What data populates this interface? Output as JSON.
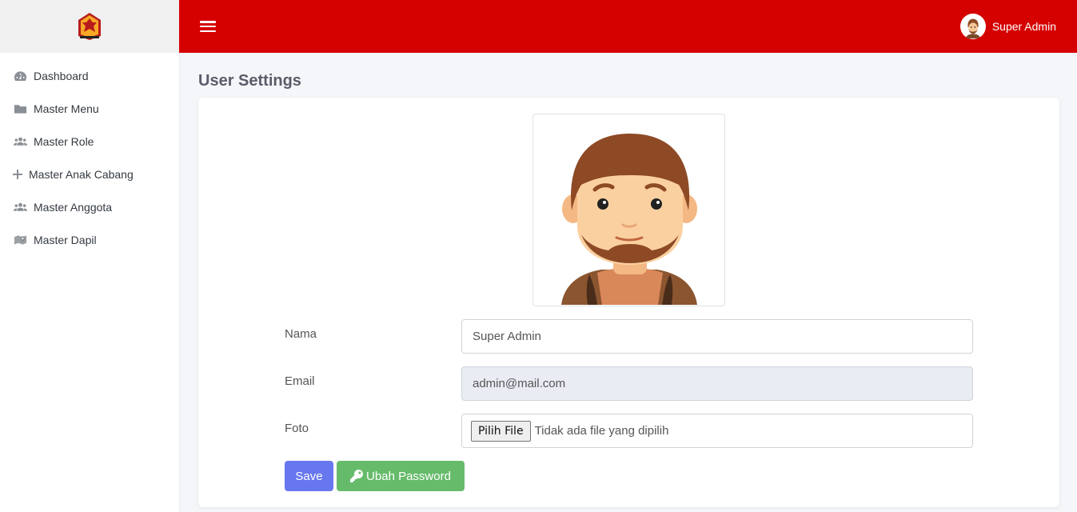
{
  "sidebar": {
    "logo_icon": "gerindra-garuda-logo",
    "items": [
      {
        "label": "Dashboard",
        "icon": "tachometer-icon"
      },
      {
        "label": "Master Menu",
        "icon": "folder-icon"
      },
      {
        "label": "Master Role",
        "icon": "users-icon"
      },
      {
        "label": "Master Anak Cabang",
        "icon": "plus-icon"
      },
      {
        "label": "Master Anggota",
        "icon": "users-icon"
      },
      {
        "label": "Master Dapil",
        "icon": "map-icon"
      }
    ]
  },
  "topbar": {
    "menu_icon": "hamburger-icon",
    "user_name": "Super Admin",
    "accent": "#d50000"
  },
  "main": {
    "page_title": "User Settings",
    "form": {
      "nama_label": "Nama",
      "nama_value": "Super Admin",
      "email_label": "Email",
      "email_value": "admin@mail.com",
      "foto_label": "Foto",
      "file_button": "Pilih File",
      "file_status": "Tidak ada file yang dipilih"
    },
    "buttons": {
      "save": "Save",
      "change_password": "Ubah Password"
    }
  },
  "colors": {
    "primary": "#6777ef",
    "success": "#66bb6a",
    "header_red": "#d50000"
  }
}
